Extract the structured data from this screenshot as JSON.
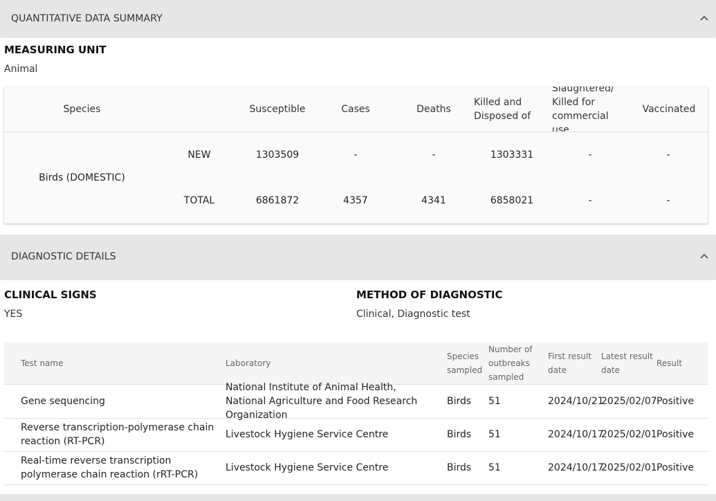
{
  "quant_section": {
    "title": "QUANTITATIVE DATA SUMMARY"
  },
  "measuring_unit": {
    "label": "MEASURING UNIT",
    "value": "Animal"
  },
  "quant_table": {
    "headers": {
      "species": "Species",
      "susceptible": "Susceptible",
      "cases": "Cases",
      "deaths": "Deaths",
      "killed_disposed": "Killed and Disposed of",
      "slaughtered": "Slaughtered/ Killed for commercial use",
      "vaccinated": "Vaccinated"
    },
    "species_name": "Birds (DOMESTIC)",
    "rows": [
      {
        "type": "NEW",
        "susceptible": "1303509",
        "cases": "-",
        "deaths": "-",
        "killed_disposed": "1303331",
        "slaughtered": "-",
        "vaccinated": "-"
      },
      {
        "type": "TOTAL",
        "susceptible": "6861872",
        "cases": "4357",
        "deaths": "4341",
        "killed_disposed": "6858021",
        "slaughtered": "-",
        "vaccinated": "-"
      }
    ]
  },
  "diag_section": {
    "title": "DIAGNOSTIC DETAILS"
  },
  "clinical_signs": {
    "label": "CLINICAL SIGNS",
    "value": "YES"
  },
  "method": {
    "label": "METHOD OF DIAGNOSTIC",
    "value": "Clinical, Diagnostic test"
  },
  "diag_table": {
    "headers": {
      "test_name": "Test name",
      "laboratory": "Laboratory",
      "species_sampled": "Species sampled",
      "outbreaks_sampled": "Number of outbreaks sampled",
      "first_result": "First result date",
      "latest_result": "Latest result date",
      "result": "Result"
    },
    "rows": [
      {
        "test_name": "Gene sequencing",
        "laboratory": "National Institute of Animal Health, National Agriculture and Food Research Organization",
        "species": "Birds",
        "outbreaks": "51",
        "first": "2024/10/21",
        "latest": "2025/02/07",
        "result": "Positive"
      },
      {
        "test_name": "Reverse transcription-polymerase chain reaction (RT-PCR)",
        "laboratory": "Livestock Hygiene Service Centre",
        "species": "Birds",
        "outbreaks": "51",
        "first": "2024/10/17",
        "latest": "2025/02/01",
        "result": "Positive"
      },
      {
        "test_name": "Real-time reverse transcription polymerase chain reaction (rRT-PCR)",
        "laboratory": "Livestock Hygiene Service Centre",
        "species": "Birds",
        "outbreaks": "51",
        "first": "2024/10/17",
        "latest": "2025/02/01",
        "result": "Positive"
      }
    ]
  },
  "icons": {
    "collapse": "chevron-up-icon"
  }
}
